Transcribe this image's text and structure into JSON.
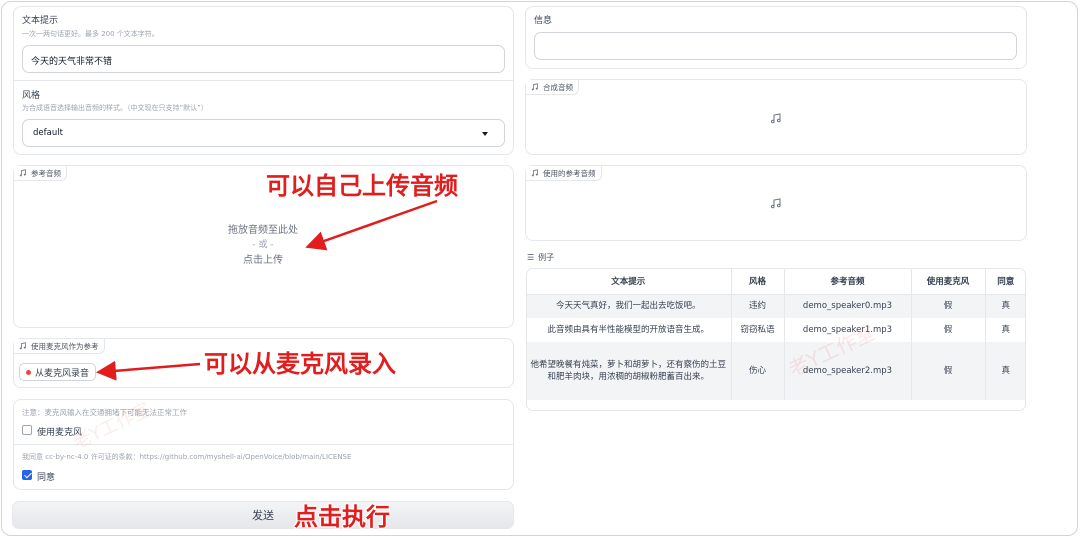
{
  "text_prompt": {
    "label": "文本提示",
    "hint": "一次一两句话更好。最多 200 个文本字符。",
    "value": "今天的天气非常不错"
  },
  "style": {
    "label": "风格",
    "hint": "为合成语音选择输出音频的样式。（中文现在只支持“默认”）",
    "value": "default"
  },
  "ref_audio": {
    "tag": "参考音频",
    "drop_text": "拖放音频至此处",
    "or_text": "- 或 -",
    "click_text": "点击上传"
  },
  "mic_ref": {
    "tag": "使用麦克风作为参考",
    "record_label": "从麦克风录音"
  },
  "mic_note": "注意：麦克风输入在交通拥堵下可能无法正常工作",
  "use_mic_label": "使用麦克风",
  "license_text": "我同意 cc-by-nc-4.0 许可证的条款：https://github.com/myshell-ai/OpenVoice/blob/main/LICENSE",
  "agree_label": "同意",
  "send_label": "发送",
  "info": {
    "label": "信息",
    "value": ""
  },
  "synth_audio": {
    "tag": "合成音频"
  },
  "used_ref_audio": {
    "tag": "使用的参考音频"
  },
  "examples": {
    "label": "例子",
    "headers": [
      "文本提示",
      "风格",
      "参考音频",
      "使用麦克风",
      "同意"
    ],
    "rows": [
      [
        "今天天气真好，我们一起出去吃饭吧。",
        "违约",
        "demo_speaker0.mp3",
        "假",
        "真"
      ],
      [
        "此音频由具有半性能模型的开放语音生成。",
        "窃窃私语",
        "demo_speaker1.mp3",
        "假",
        "真"
      ],
      [
        "他希望晚餐有炖菜，萝卜和胡萝卜，还有察伤的土豆和肥羊肉块，用浓稠的胡椒粉肥蓄百出来。",
        "伤心",
        "demo_speaker2.mp3",
        "假",
        "真"
      ]
    ]
  },
  "annotations": {
    "upload": "可以自己上传音频",
    "mic": "可以从麦克风录入",
    "run": "点击执行"
  },
  "watermark": "老Y工作室",
  "colors": {
    "annotation": "#e11d1d",
    "checkbox": "#2563eb",
    "record_dot": "#ef4444"
  }
}
